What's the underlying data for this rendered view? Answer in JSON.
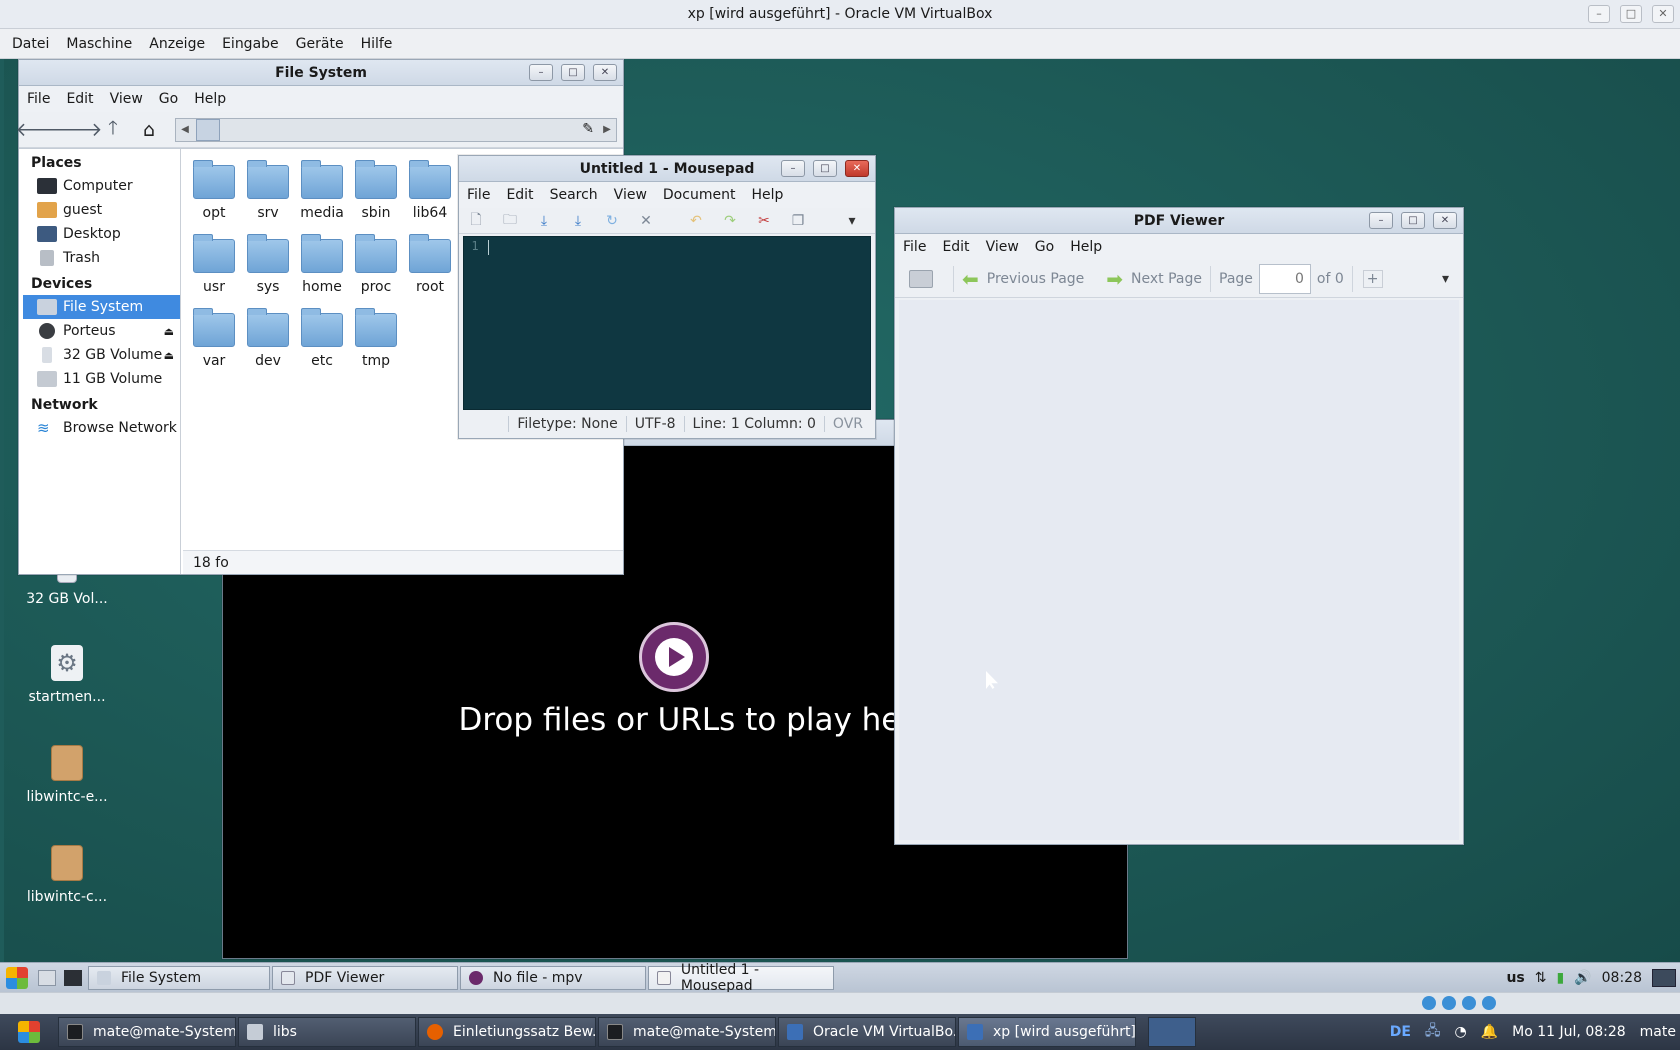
{
  "host": {
    "title": "xp  [wird ausgeführt] - Oracle VM VirtualBox",
    "menu": [
      "Datei",
      "Maschine",
      "Anzeige",
      "Eingabe",
      "Geräte",
      "Hilfe"
    ]
  },
  "filesystem": {
    "title": "File System",
    "menu": [
      "File",
      "Edit",
      "View",
      "Go",
      "Help"
    ],
    "sections": {
      "places": "Places",
      "devices": "Devices",
      "network": "Network"
    },
    "places": [
      "Computer",
      "guest",
      "Desktop",
      "Trash"
    ],
    "devices": [
      "File System",
      "Porteus",
      "32 GB Volume",
      "11 GB Volume"
    ],
    "network": [
      "Browse Network"
    ],
    "folders": [
      "opt",
      "srv",
      "media",
      "sbin",
      "lib64",
      "usr",
      "sys",
      "home",
      "proc",
      "root",
      "var",
      "dev",
      "etc",
      "tmp"
    ],
    "status": "18 fo"
  },
  "mousepad": {
    "title": "Untitled 1 - Mousepad",
    "menu": [
      "File",
      "Edit",
      "Search",
      "View",
      "Document",
      "Help"
    ],
    "line_number": "1",
    "status": {
      "filetype": "Filetype: None",
      "encoding": "UTF-8",
      "position": "Line: 1 Column: 0",
      "mode": "OVR"
    }
  },
  "mpv": {
    "drop_text": "Drop files or URLs to play here"
  },
  "pdf": {
    "title": "PDF Viewer",
    "menu": [
      "File",
      "Edit",
      "View",
      "Go",
      "Help"
    ],
    "prev": "Previous Page",
    "next": "Next Page",
    "page_label": "Page",
    "page_value": "0",
    "page_of": "of 0"
  },
  "desktop_icons": [
    "32 GB Vol...",
    "startmen...",
    "libwintc-e...",
    "libwintc-c..."
  ],
  "guest_panel": {
    "tasks": [
      "File System",
      "PDF Viewer",
      "No file - mpv",
      "Untitled 1 - Mousepad"
    ],
    "layout": "us",
    "time": "08:28"
  },
  "host_taskbar": {
    "tasks": [
      "mate@mate-System...",
      "libs",
      "Einletiungssatz Bew...",
      "mate@mate-System...",
      "Oracle VM VirtualBo...",
      "xp  [wird ausgeführt]..."
    ],
    "lang": "DE",
    "datetime": "Mo 11 Jul, 08:28",
    "user": "mate"
  }
}
